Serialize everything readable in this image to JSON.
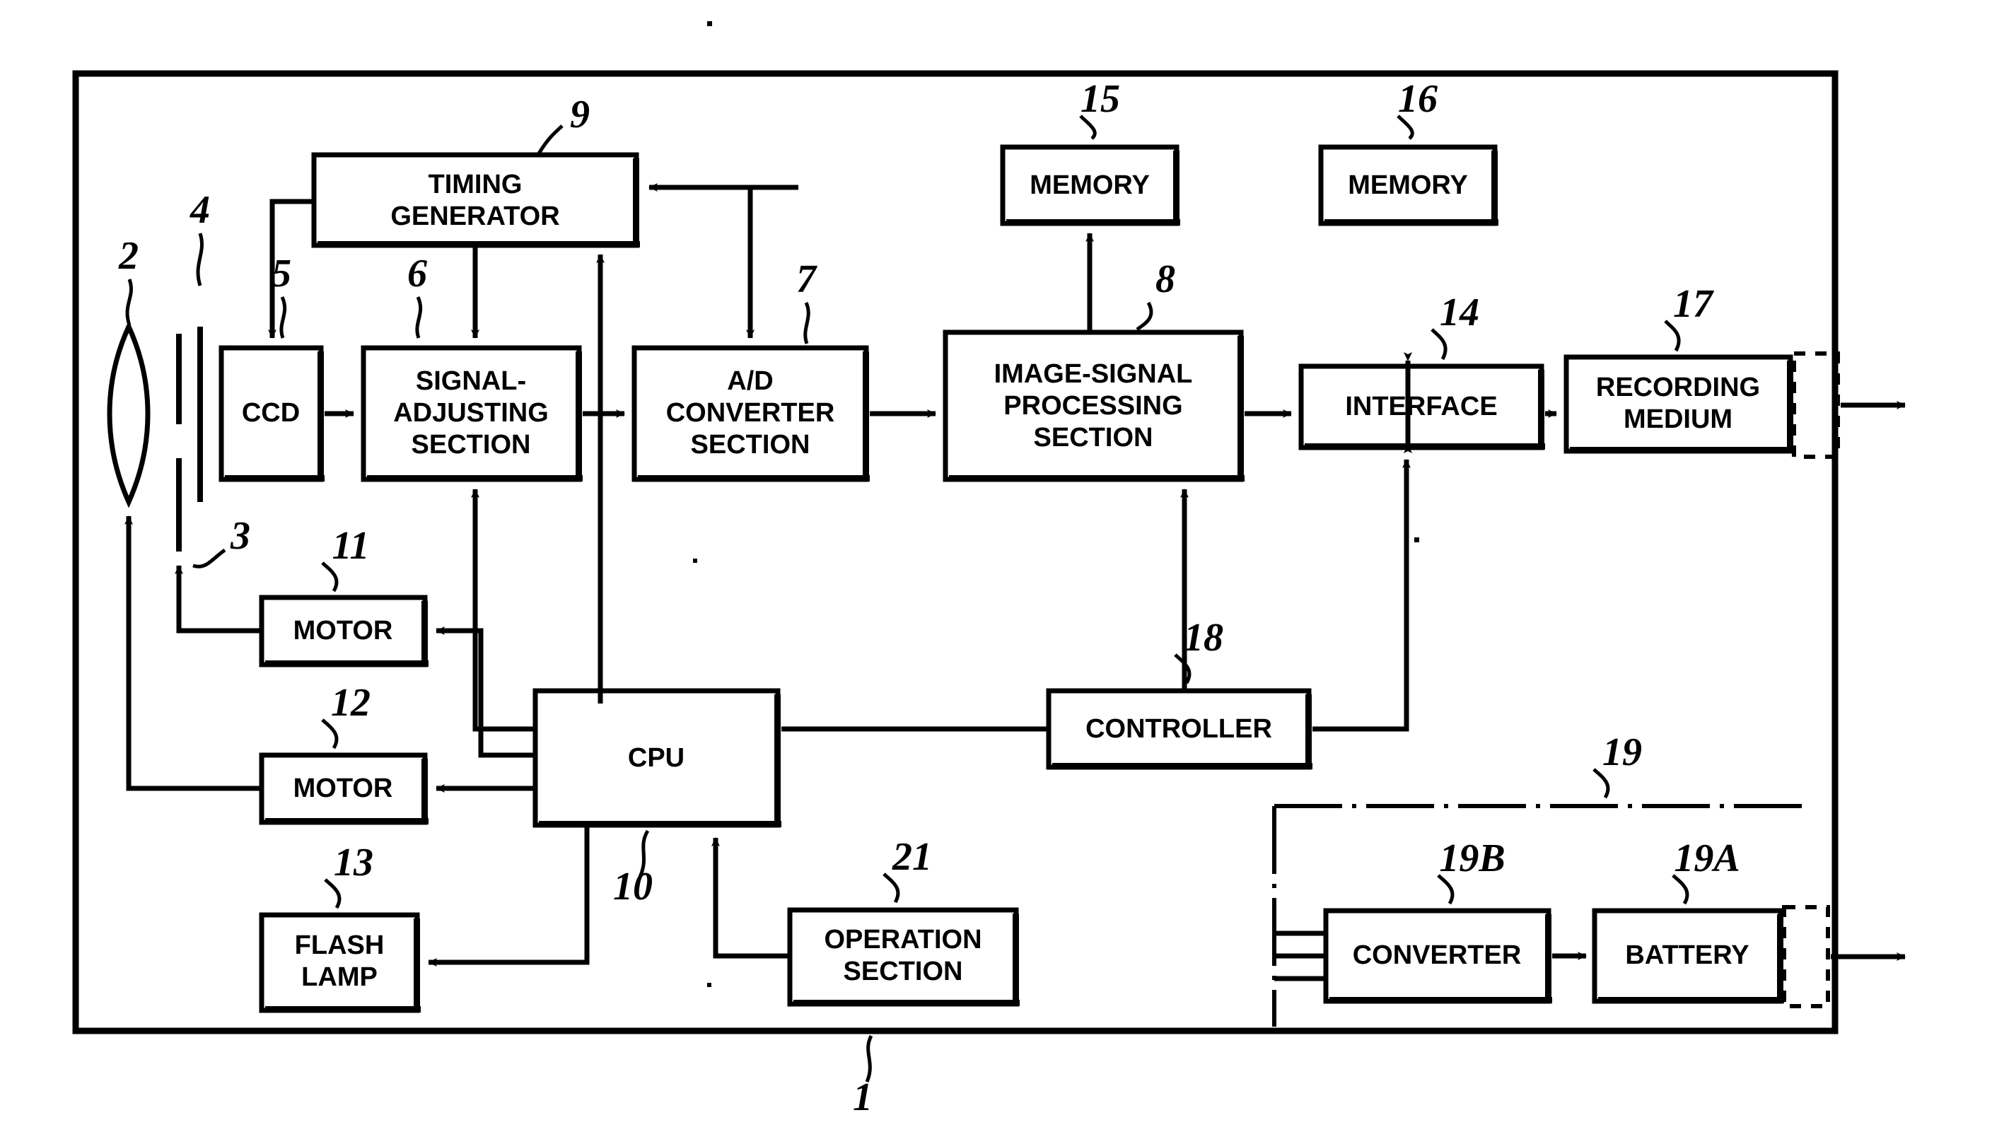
{
  "figure": {
    "type": "patent-block-diagram",
    "title": "Digital camera block diagram",
    "device_ref": "1"
  },
  "blocks": {
    "ccd": {
      "label": "CCD",
      "ref": "5"
    },
    "signal_adj": {
      "label": [
        "SIGNAL-",
        "ADJUSTING",
        "SECTION"
      ],
      "ref": "6"
    },
    "ad_conv": {
      "label": [
        "A/D",
        "CONVERTER",
        "SECTION"
      ],
      "ref": "7"
    },
    "img_proc": {
      "label": [
        "IMAGE-SIGNAL",
        "PROCESSING",
        "SECTION"
      ],
      "ref": "8"
    },
    "timing_gen": {
      "label": [
        "TIMING",
        "GENERATOR"
      ],
      "ref": "9"
    },
    "cpu": {
      "label": "CPU",
      "ref": "10"
    },
    "motor1": {
      "label": "MOTOR",
      "ref": "11"
    },
    "motor2": {
      "label": "MOTOR",
      "ref": "12"
    },
    "flash_lamp": {
      "label": [
        "FLASH",
        "LAMP"
      ],
      "ref": "13"
    },
    "interface": {
      "label": "INTERFACE",
      "ref": "14"
    },
    "memory1": {
      "label": "MEMORY",
      "ref": "15"
    },
    "memory2": {
      "label": "MEMORY",
      "ref": "16"
    },
    "recording": {
      "label": [
        "RECORDING",
        "MEDIUM"
      ],
      "ref": "17"
    },
    "controller": {
      "label": "CONTROLLER",
      "ref": "18"
    },
    "power_unit": {
      "label": "",
      "ref": "19"
    },
    "battery": {
      "label": "BATTERY",
      "ref": "19A"
    },
    "converter": {
      "label": "CONVERTER",
      "ref": "19B"
    },
    "operation": {
      "label": [
        "OPERATION",
        "SECTION"
      ],
      "ref": "21"
    }
  },
  "optics": {
    "lens": {
      "ref": "2"
    },
    "aperture": {
      "ref": "3"
    },
    "shutter": {
      "ref": "4"
    }
  },
  "refs": {
    "r1": "1",
    "r2": "2",
    "r3": "3",
    "r4": "4",
    "r5": "5",
    "r6": "6",
    "r7": "7",
    "r8": "8",
    "r9": "9",
    "r10": "10",
    "r11": "11",
    "r12": "12",
    "r13": "13",
    "r14": "14",
    "r15": "15",
    "r16": "16",
    "r17": "17",
    "r18": "18",
    "r19": "19",
    "r19A": "19A",
    "r19B": "19B",
    "r21": "21"
  },
  "colors": {
    "ink": "#000000",
    "paper": "#ffffff"
  }
}
